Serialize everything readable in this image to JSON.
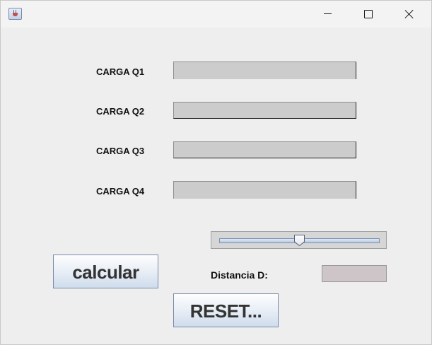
{
  "window": {
    "title": ""
  },
  "fields": [
    {
      "label": "CARGA Q1",
      "value": ""
    },
    {
      "label": "CARGA Q2",
      "value": ""
    },
    {
      "label": "CARGA Q3",
      "value": ""
    },
    {
      "label": "CARGA Q4",
      "value": ""
    }
  ],
  "slider": {
    "level_fraction": 0.5
  },
  "buttons": {
    "calcular": "calcular",
    "reset": "RESET..."
  },
  "distance": {
    "label": "Distancia D:",
    "value": ""
  },
  "icons": {
    "app": "java-coffee-icon",
    "minimize": "minimize-icon",
    "maximize": "maximize-icon",
    "close": "close-icon"
  },
  "colors": {
    "field_bg": "#cccccc",
    "button_gradient_top": "#fdfdfe",
    "button_gradient_bottom": "#cfdcec",
    "distance_output_bg": "#cdc5c8"
  }
}
